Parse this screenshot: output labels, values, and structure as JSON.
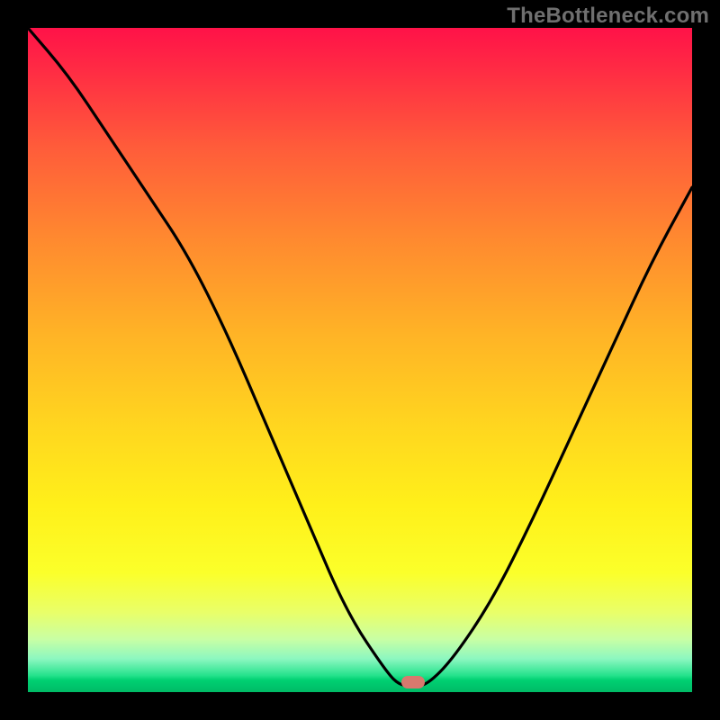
{
  "attribution": "TheBottleneck.com",
  "colors": {
    "page_bg": "#000000",
    "attribution_text": "#6f6f6f",
    "curve_stroke": "#000000",
    "marker_fill": "#d9796e",
    "gradient_top": "#ff1248",
    "gradient_mid": "#fff01a",
    "gradient_bottom": "#00bb66"
  },
  "chart_data": {
    "type": "line",
    "title": "",
    "xlabel": "",
    "ylabel": "",
    "xlim": [
      0,
      100
    ],
    "ylim": [
      0,
      100
    ],
    "grid": false,
    "legend": false,
    "series": [
      {
        "name": "bottleneck-curve",
        "x": [
          0,
          6,
          12,
          18,
          24,
          30,
          36,
          42,
          48,
          54,
          56,
          58,
          60,
          64,
          70,
          76,
          82,
          88,
          94,
          100
        ],
        "values": [
          100,
          93,
          84,
          75,
          66,
          54,
          40,
          26,
          12,
          3,
          1,
          1,
          1,
          5,
          14,
          26,
          39,
          52,
          65,
          76
        ]
      }
    ],
    "marker": {
      "x": 58,
      "y": 1.5
    },
    "annotations": []
  }
}
